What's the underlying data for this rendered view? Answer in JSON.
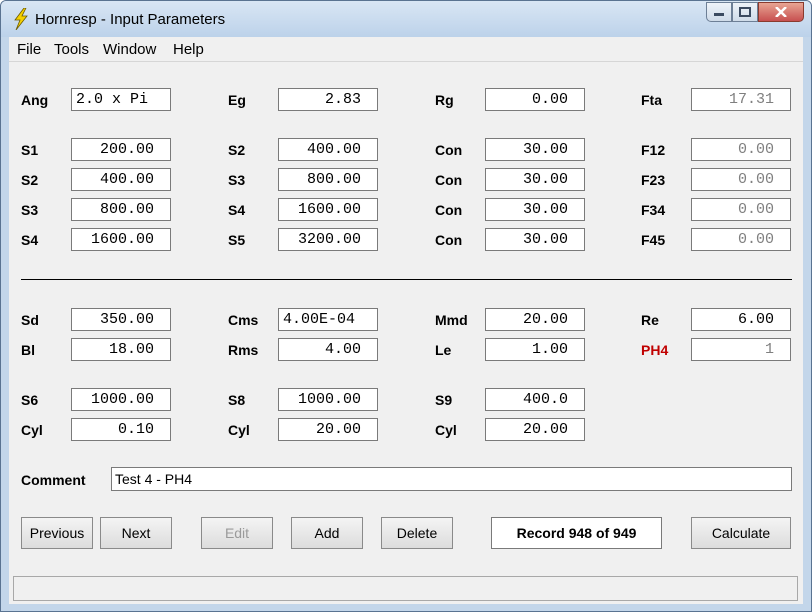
{
  "window": {
    "title": "Hornresp - Input Parameters"
  },
  "menu": {
    "file": "File",
    "tools": "Tools",
    "window": "Window",
    "help": "Help"
  },
  "params": {
    "ang_label": "Ang",
    "ang": "2.0 x Pi",
    "eg_label": "Eg",
    "eg": "2.83",
    "rg_label": "Rg",
    "rg": "0.00",
    "fta_label": "Fta",
    "fta": "17.31",
    "rows": [
      {
        "a_label": "S1",
        "a": "200.00",
        "b_label": "S2",
        "b": "400.00",
        "c_label": "Con",
        "c": "30.00",
        "d_label": "F12",
        "d": "0.00"
      },
      {
        "a_label": "S2",
        "a": "400.00",
        "b_label": "S3",
        "b": "800.00",
        "c_label": "Con",
        "c": "30.00",
        "d_label": "F23",
        "d": "0.00"
      },
      {
        "a_label": "S3",
        "a": "800.00",
        "b_label": "S4",
        "b": "1600.00",
        "c_label": "Con",
        "c": "30.00",
        "d_label": "F34",
        "d": "0.00"
      },
      {
        "a_label": "S4",
        "a": "1600.00",
        "b_label": "S5",
        "b": "3200.00",
        "c_label": "Con",
        "c": "30.00",
        "d_label": "F45",
        "d": "0.00"
      }
    ]
  },
  "driver": {
    "sd_label": "Sd",
    "sd": "350.00",
    "cms_label": "Cms",
    "cms": "4.00E-04",
    "mmd_label": "Mmd",
    "mmd": "20.00",
    "re_label": "Re",
    "re": "6.00",
    "bl_label": "Bl",
    "bl": "18.00",
    "rms_label": "Rms",
    "rms": "4.00",
    "le_label": "Le",
    "le": "1.00",
    "ph_label": "PH4",
    "ph": "1"
  },
  "chambers": {
    "s6_label": "S6",
    "s6": "1000.00",
    "s8_label": "S8",
    "s8": "1000.00",
    "s9_label": "S9",
    "s9": "400.0",
    "cyl1_label": "Cyl",
    "cyl1": "0.10",
    "cyl2_label": "Cyl",
    "cyl2": "20.00",
    "cyl3_label": "Cyl",
    "cyl3": "20.00"
  },
  "comment": {
    "label": "Comment",
    "value": "Test 4 - PH4"
  },
  "buttons": {
    "previous": "Previous",
    "next": "Next",
    "edit": "Edit",
    "add": "Add",
    "delete": "Delete",
    "record": "Record 948 of 949",
    "calculate": "Calculate"
  },
  "colors": {
    "title_bg": "#c3d6ea",
    "client_bg": "#f0f0f0",
    "ph_label": "#c00000",
    "readonly_text": "#7f7f7f"
  }
}
